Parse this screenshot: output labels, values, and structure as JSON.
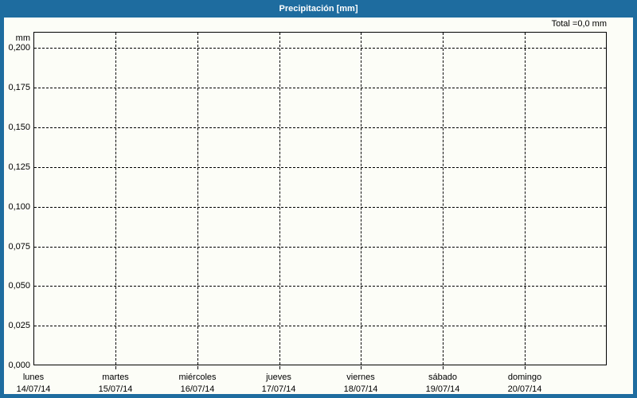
{
  "header": {
    "title": "Precipitación [mm]"
  },
  "summary": {
    "total_label": "Total =0,0 mm"
  },
  "y_axis": {
    "unit_label": "mm",
    "ticks": [
      "0,200",
      "0,175",
      "0,150",
      "0,125",
      "0,100",
      "0,075",
      "0,050",
      "0,025",
      "0,000"
    ]
  },
  "x_axis": {
    "days": [
      {
        "name": "lunes",
        "date": "14/07/14"
      },
      {
        "name": "martes",
        "date": "15/07/14"
      },
      {
        "name": "miércoles",
        "date": "16/07/14"
      },
      {
        "name": "jueves",
        "date": "17/07/14"
      },
      {
        "name": "viernes",
        "date": "18/07/14"
      },
      {
        "name": "sábado",
        "date": "19/07/14"
      },
      {
        "name": "domingo",
        "date": "20/07/14"
      }
    ]
  },
  "colors": {
    "header_bg": "#1e6c9f",
    "frame_border": "#1e6c9f",
    "canvas_bg": "#fcfdf7",
    "grid": "#000000",
    "title_text": "#ffffff",
    "label_text": "#000000"
  },
  "chart_data": {
    "type": "line",
    "title": "Precipitación [mm]",
    "xlabel": "",
    "ylabel": "mm",
    "x": [
      "14/07/14",
      "15/07/14",
      "16/07/14",
      "17/07/14",
      "18/07/14",
      "19/07/14",
      "20/07/14"
    ],
    "x_day_names": [
      "lunes",
      "martes",
      "miércoles",
      "jueves",
      "viernes",
      "sábado",
      "domingo"
    ],
    "series": [
      {
        "name": "Precipitación",
        "values": [
          0.0,
          0.0,
          0.0,
          0.0,
          0.0,
          0.0,
          0.0
        ]
      }
    ],
    "total_mm": 0.0,
    "ylim": [
      0.0,
      0.21
    ],
    "yticks": [
      0.0,
      0.025,
      0.05,
      0.075,
      0.1,
      0.125,
      0.15,
      0.175,
      0.2
    ],
    "ytick_labels": [
      "0,000",
      "0,025",
      "0,050",
      "0,075",
      "0,100",
      "0,125",
      "0,150",
      "0,175",
      "0,200"
    ],
    "grid": true,
    "legend": false,
    "annotations": [
      "Total =0,0 mm"
    ]
  }
}
